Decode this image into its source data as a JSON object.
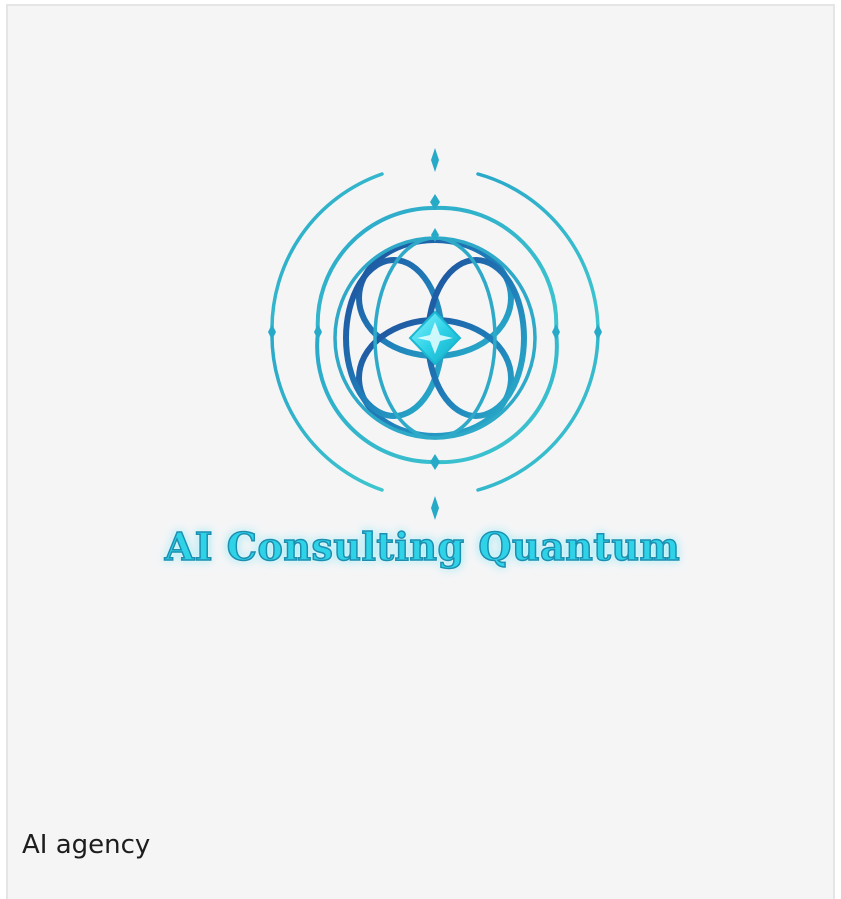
{
  "card": {
    "brand_name": "AI Consulting Quantum",
    "caption": "AI agency"
  },
  "logo": {
    "icon": "quantum-orbital-emblem-icon",
    "colors": {
      "teal": "#33bfd0",
      "blue": "#1f5fa6",
      "cyan_gem": "#2fd3e8",
      "wordmark_outline": "#1c8fb1"
    }
  }
}
